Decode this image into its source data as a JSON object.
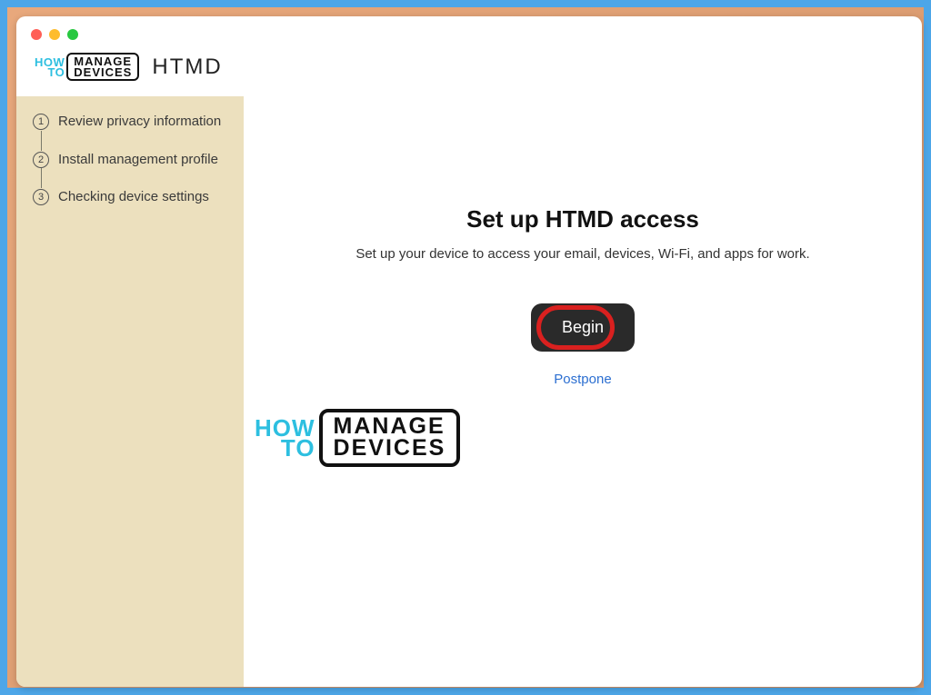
{
  "brand": {
    "how": "HOW",
    "to": "TO",
    "manage": "MANAGE",
    "devices": "DEVICES",
    "title": "HTMD"
  },
  "sidebar": {
    "steps": [
      {
        "num": "1",
        "label": "Review privacy information"
      },
      {
        "num": "2",
        "label": "Install management profile"
      },
      {
        "num": "3",
        "label": "Checking device settings"
      }
    ]
  },
  "main": {
    "title": "Set up HTMD access",
    "subtitle": "Set up your device to access your email, devices, Wi-Fi, and apps for work.",
    "begin_label": "Begin",
    "postpone_label": "Postpone"
  },
  "watermark": {
    "how": "HOW",
    "to": "TO",
    "manage": "MANAGE",
    "devices": "DEVICES"
  }
}
